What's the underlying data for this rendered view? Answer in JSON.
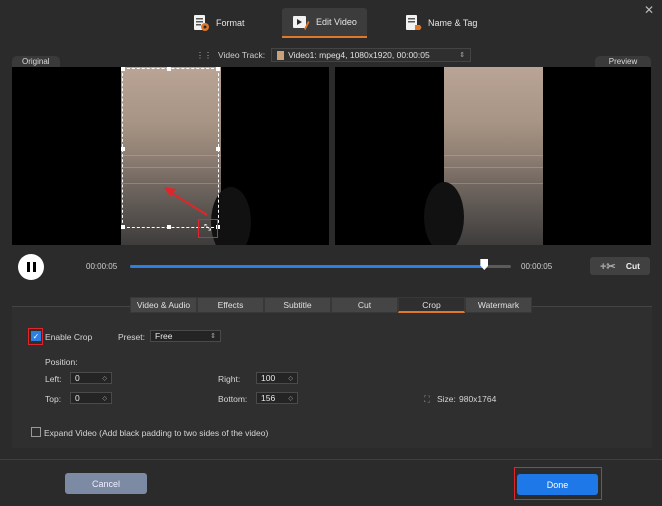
{
  "window": {
    "close_glyph": "✕"
  },
  "tabs": [
    {
      "label": "Format",
      "icon": "format-icon",
      "active": false
    },
    {
      "label": "Edit Video",
      "icon": "edit-video-icon",
      "active": true
    },
    {
      "label": "Name & Tag",
      "icon": "name-tag-icon",
      "active": false
    }
  ],
  "video_track": {
    "label": "Video Track:",
    "value": "Video1: mpeg4, 1080x1920, 00:00:05"
  },
  "panes": {
    "original_label": "Original",
    "preview_label": "Preview"
  },
  "playback": {
    "current_time": "00:00:05",
    "total_time": "00:00:05",
    "progress": 0.93,
    "cut_label": "Cut"
  },
  "subtabs": [
    {
      "label": "Video & Audio",
      "active": false
    },
    {
      "label": "Effects",
      "active": false
    },
    {
      "label": "Subtitle",
      "active": false
    },
    {
      "label": "Cut",
      "active": false
    },
    {
      "label": "Crop",
      "active": true
    },
    {
      "label": "Watermark",
      "active": false
    }
  ],
  "crop": {
    "enable_label": "Enable Crop",
    "enabled": true,
    "preset_label": "Preset:",
    "preset_value": "Free",
    "position_label": "Position:",
    "left_label": "Left:",
    "left_value": "0",
    "right_label": "Right:",
    "right_value": "100",
    "top_label": "Top:",
    "top_value": "0",
    "bottom_label": "Bottom:",
    "bottom_value": "156",
    "size_label": "Size:",
    "size_value": "980x1764",
    "expand_label": "Expand Video (Add black padding to two sides of the video)",
    "expand_checked": false
  },
  "footer": {
    "cancel_label": "Cancel",
    "done_label": "Done"
  },
  "colors": {
    "accent": "#2d7fe0",
    "highlight": "#e0262a",
    "tab_underline": "#e0782c"
  }
}
